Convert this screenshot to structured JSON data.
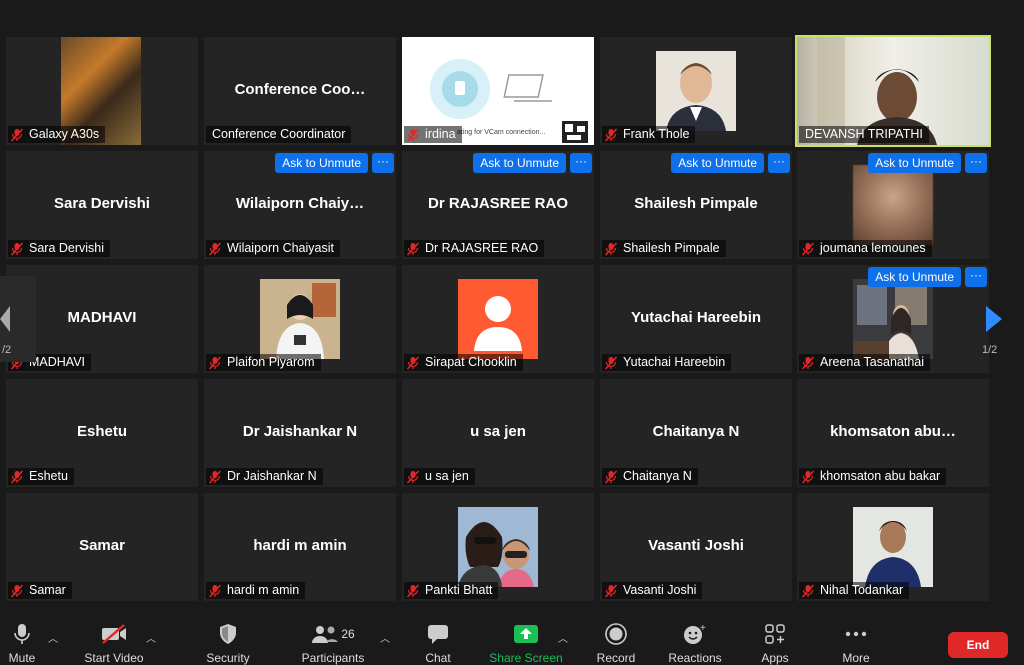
{
  "colors": {
    "accent_blue": "#0e71eb",
    "active_border": "#c9e265",
    "end_red": "#e02828",
    "share_green": "#1bbf54",
    "tile_bg": "#242424"
  },
  "nav": {
    "left_page": "/2",
    "right_page": "1/2"
  },
  "tiles": [
    {
      "name": "",
      "label": "Galaxy A30s",
      "muted": true,
      "photo": "storefront"
    },
    {
      "name": "Conference  Coo…",
      "label": "Conference Coordinator",
      "muted": false
    },
    {
      "name": "",
      "label": "irdina",
      "muted": true,
      "photo": "vcam"
    },
    {
      "name": "",
      "label": "Frank Thole",
      "muted": true,
      "photo": "man"
    },
    {
      "name": "",
      "label": "DEVANSH TRIPATHI",
      "muted": false,
      "photo": "video",
      "active": true
    },
    {
      "name": "Sara Dervishi",
      "label": "Sara Dervishi",
      "muted": true
    },
    {
      "name": "Wilaiporn  Chaiy…",
      "label": "Wilaiporn Chaiyasit",
      "muted": true,
      "unmute": true
    },
    {
      "name": "Dr RAJASREE RAO",
      "label": "Dr RAJASREE RAO",
      "muted": true,
      "unmute": true
    },
    {
      "name": "Shailesh Pimpale",
      "label": "Shailesh Pimpale",
      "muted": true,
      "unmute": true
    },
    {
      "name": "",
      "label": "joumana lemounes",
      "muted": true,
      "unmute": true,
      "photo": "blur"
    },
    {
      "name": "MADHAVI",
      "label": "MADHAVI",
      "muted": true
    },
    {
      "name": "",
      "label": "Plaifon Piyarom",
      "muted": true,
      "photo": "woman"
    },
    {
      "name": "",
      "label": "Sirapat Chooklin",
      "muted": true,
      "photo": "avatar"
    },
    {
      "name": "Yutachai Hareebin",
      "label": "Yutachai Hareebin",
      "muted": true
    },
    {
      "name": "",
      "label": "Areena Tasanathai",
      "muted": true,
      "unmute": true,
      "photo": "room"
    },
    {
      "name": "Eshetu",
      "label": "Eshetu",
      "muted": true
    },
    {
      "name": "Dr Jaishankar N",
      "label": "Dr Jaishankar N",
      "muted": true
    },
    {
      "name": "u sa jen",
      "label": "u sa jen",
      "muted": true
    },
    {
      "name": "Chaitanya N",
      "label": "Chaitanya N",
      "muted": true
    },
    {
      "name": "khomsaton  abu…",
      "label": "khomsaton abu  bakar",
      "muted": true
    },
    {
      "name": "Samar",
      "label": "Samar",
      "muted": true
    },
    {
      "name": "hardi m amin",
      "label": "hardi m amin",
      "muted": true
    },
    {
      "name": "",
      "label": "Pankti Bhatt",
      "muted": true,
      "photo": "two"
    },
    {
      "name": "Vasanti Joshi",
      "label": "Vasanti Joshi",
      "muted": true
    },
    {
      "name": "",
      "label": "Nihal Todankar",
      "muted": true,
      "photo": "boy"
    }
  ],
  "unmute": {
    "label": "Ask to Unmute",
    "more": "···"
  },
  "vcam_text": "ating for VCam connection...",
  "toolbar": {
    "mute": "Mute",
    "start_video": "Start Video",
    "security": "Security",
    "participants": "Participants",
    "participants_count": "26",
    "chat": "Chat",
    "share_screen": "Share Screen",
    "record": "Record",
    "reactions": "Reactions",
    "apps": "Apps",
    "more": "More",
    "end": "End"
  }
}
